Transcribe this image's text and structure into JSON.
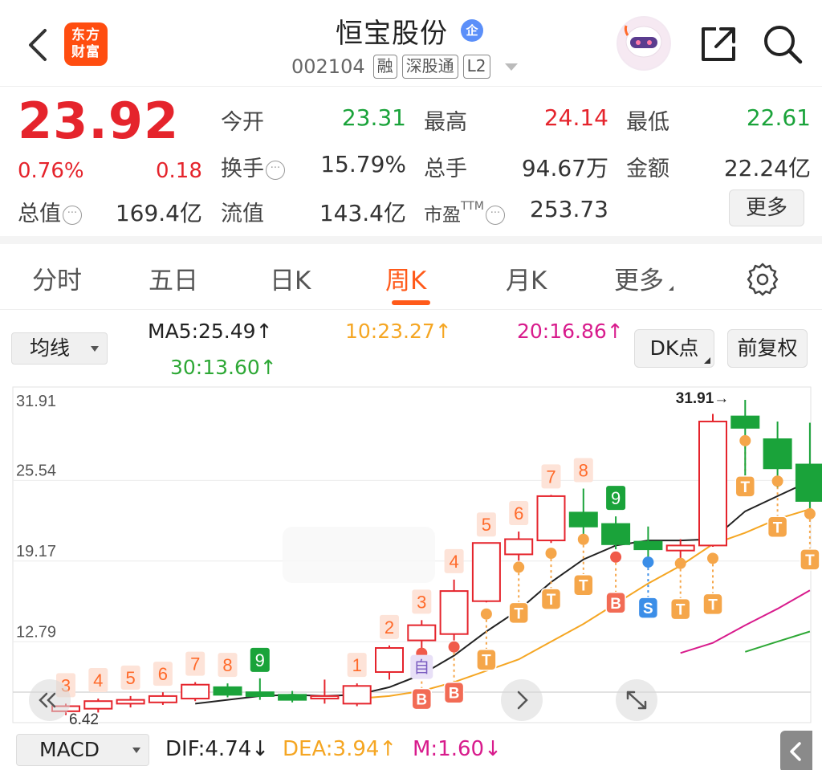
{
  "header": {
    "logo_line1": "东方",
    "logo_line2": "财富",
    "stock_name": "恒宝股份",
    "badge": "企",
    "code": "002104",
    "tags": [
      "融",
      "深股通",
      "L2"
    ]
  },
  "quote": {
    "price": "23.92",
    "change_pct": "0.76%",
    "change": "0.18",
    "fields": {
      "open_label": "今开",
      "open": "23.31",
      "high_label": "最高",
      "high": "24.14",
      "low_label": "最低",
      "low": "22.61",
      "turnover_label": "换手",
      "turnover": "15.79%",
      "volume_label": "总手",
      "volume": "94.67万",
      "amount_label": "金额",
      "amount": "22.24亿",
      "mktcap_label": "总值",
      "mktcap": "169.4亿",
      "float_label": "流值",
      "float": "143.4亿",
      "pe_label": "市盈",
      "pe_sup": "TTM",
      "pe": "253.73"
    },
    "more_label": "更多"
  },
  "tabs": {
    "items": [
      "分时",
      "五日",
      "日K",
      "周K",
      "月K",
      "更多"
    ],
    "active": "周K"
  },
  "indicators": {
    "ma_select": "均线",
    "ma5": "MA5:25.49↑",
    "ma10": "10:23.27↑",
    "ma20": "20:16.86↑",
    "ma30": "30:13.60↑",
    "dk_label": "DK点",
    "fq_label": "前复权"
  },
  "colors": {
    "up": "#e5242c",
    "down": "#1aa33a",
    "ma5": "#222222",
    "ma10": "#f5a623",
    "ma20": "#d81b8c",
    "ma30": "#2ea836",
    "marker_orange": "#f5a64a",
    "accent": "#ff5a1a"
  },
  "chart_data": {
    "type": "candlestick",
    "y_ticks": [
      "31.91",
      "25.54",
      "19.17",
      "12.79"
    ],
    "y_tick_values": [
      31.91,
      25.54,
      19.17,
      12.79
    ],
    "ylim": [
      6.4,
      31.91
    ],
    "max_annotation": "31.91→",
    "low_annotation": "6.42",
    "candles": [
      {
        "o": 7.3,
        "c": 7.7,
        "h": 7.9,
        "l": 7.0,
        "label": "3"
      },
      {
        "o": 7.5,
        "c": 8.1,
        "h": 8.3,
        "l": 7.2,
        "label": "4"
      },
      {
        "o": 7.9,
        "c": 8.2,
        "h": 8.5,
        "l": 7.6,
        "label": "5"
      },
      {
        "o": 8.0,
        "c": 8.5,
        "h": 8.8,
        "l": 7.8,
        "label": "6"
      },
      {
        "o": 8.3,
        "c": 9.4,
        "h": 9.6,
        "l": 8.1,
        "label": "7"
      },
      {
        "o": 9.2,
        "c": 8.6,
        "h": 9.5,
        "l": 8.4,
        "label": "8"
      },
      {
        "o": 8.8,
        "c": 8.5,
        "h": 9.9,
        "l": 8.2,
        "label": "9"
      },
      {
        "o": 8.6,
        "c": 8.2,
        "h": 8.9,
        "l": 8.0,
        "label": ""
      },
      {
        "o": 8.3,
        "c": 8.5,
        "h": 9.8,
        "l": 7.9,
        "label": ""
      },
      {
        "o": 7.9,
        "c": 9.3,
        "h": 9.5,
        "l": 7.7,
        "label": "1"
      },
      {
        "o": 10.4,
        "c": 12.3,
        "h": 12.5,
        "l": 9.8,
        "label": "2"
      },
      {
        "o": 12.9,
        "c": 14.1,
        "h": 14.5,
        "l": 12.2,
        "label": "3"
      },
      {
        "o": 13.4,
        "c": 16.8,
        "h": 17.7,
        "l": 12.9,
        "label": "4"
      },
      {
        "o": 16.0,
        "c": 20.6,
        "h": 20.6,
        "l": 15.9,
        "label": "5"
      },
      {
        "o": 19.7,
        "c": 20.9,
        "h": 21.5,
        "l": 19.2,
        "label": "6"
      },
      {
        "o": 20.8,
        "c": 24.3,
        "h": 24.4,
        "l": 20.6,
        "label": "7"
      },
      {
        "o": 23.0,
        "c": 21.9,
        "h": 24.9,
        "l": 20.8,
        "label": "8"
      },
      {
        "o": 22.1,
        "c": 20.5,
        "h": 22.7,
        "l": 20.1,
        "label": "9"
      },
      {
        "o": 20.7,
        "c": 20.1,
        "h": 21.9,
        "l": 19.4,
        "label": ""
      },
      {
        "o": 20.0,
        "c": 20.4,
        "h": 20.9,
        "l": 19.1,
        "label": ""
      },
      {
        "o": 20.4,
        "c": 30.2,
        "h": 30.8,
        "l": 20.3,
        "label": ""
      },
      {
        "o": 30.6,
        "c": 29.7,
        "h": 31.91,
        "l": 25.3,
        "label": ""
      },
      {
        "o": 28.8,
        "c": 26.5,
        "h": 30.2,
        "l": 25.0,
        "label": ""
      },
      {
        "o": 26.8,
        "c": 23.92,
        "h": 30.1,
        "l": 22.61,
        "label": ""
      }
    ],
    "series": [
      {
        "name": "MA5",
        "values": [
          null,
          null,
          null,
          null,
          7.9,
          8.2,
          8.5,
          8.6,
          8.5,
          8.6,
          9.2,
          10.2,
          11.7,
          13.6,
          15.3,
          17.5,
          19.3,
          20.4,
          20.8,
          20.8,
          20.9,
          23.1,
          24.3,
          25.49
        ]
      },
      {
        "name": "10",
        "values": [
          null,
          null,
          null,
          null,
          null,
          null,
          null,
          null,
          null,
          8.3,
          8.5,
          8.9,
          9.6,
          10.5,
          11.4,
          12.8,
          14.2,
          15.8,
          17.4,
          18.8,
          20.5,
          21.4,
          22.5,
          23.27
        ]
      },
      {
        "name": "20",
        "values": [
          null,
          null,
          null,
          null,
          null,
          null,
          null,
          null,
          null,
          null,
          null,
          null,
          null,
          null,
          null,
          null,
          null,
          null,
          null,
          11.9,
          12.7,
          14.1,
          15.4,
          16.86
        ]
      },
      {
        "name": "30",
        "values": [
          null,
          null,
          null,
          null,
          null,
          null,
          null,
          null,
          null,
          null,
          null,
          null,
          null,
          null,
          null,
          null,
          null,
          null,
          null,
          null,
          null,
          12.0,
          12.8,
          13.6
        ]
      }
    ],
    "trade_markers": [
      {
        "i": 11,
        "type": "B",
        "extra": "自"
      },
      {
        "i": 12,
        "type": "B"
      },
      {
        "i": 13,
        "type": "T"
      },
      {
        "i": 14,
        "type": "T"
      },
      {
        "i": 15,
        "type": "T"
      },
      {
        "i": 16,
        "type": "T"
      },
      {
        "i": 17,
        "type": "B"
      },
      {
        "i": 18,
        "type": "S"
      },
      {
        "i": 19,
        "type": "T"
      },
      {
        "i": 20,
        "type": "T"
      },
      {
        "i": 21,
        "type": "T"
      },
      {
        "i": 22,
        "type": "T"
      },
      {
        "i": 23,
        "type": "T"
      }
    ]
  },
  "macd": {
    "select": "MACD",
    "dif": "DIF:4.74↓",
    "dea": "DEA:3.94↑",
    "m": "M:1.60↓"
  }
}
